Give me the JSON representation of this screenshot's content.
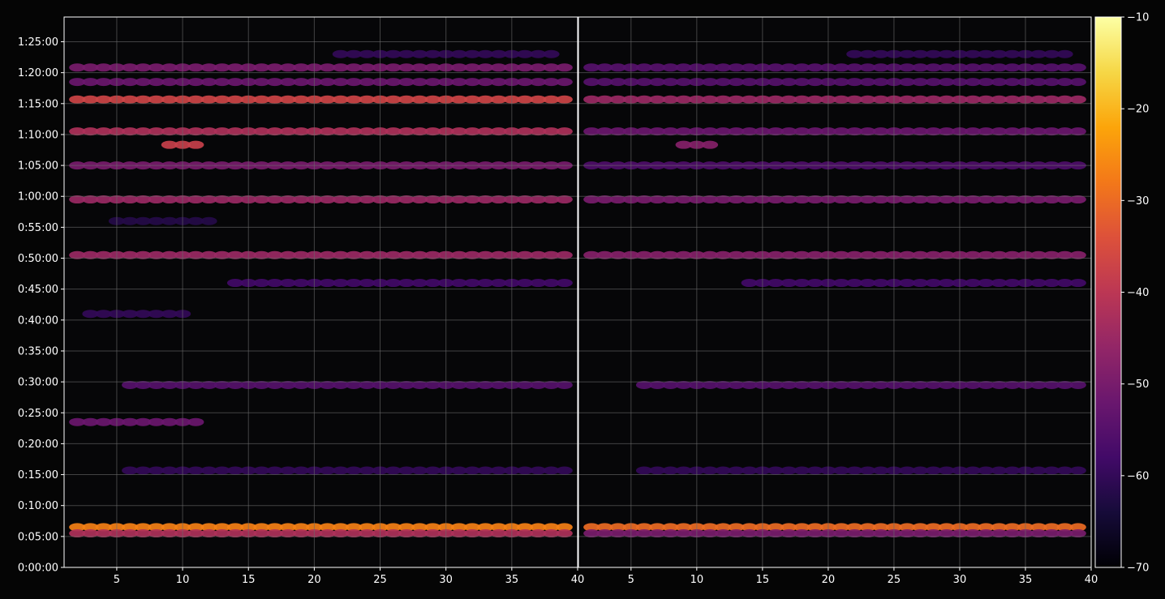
{
  "chart_data": {
    "type": "heatmap",
    "title": "",
    "xlabel": "",
    "ylabel": "",
    "panels": [
      {
        "name": "left",
        "xlim": [
          1,
          40
        ]
      },
      {
        "name": "right",
        "xlim": [
          40,
          40
        ]
      }
    ],
    "xlim": [
      1,
      40
    ],
    "x_ticks": [
      "5",
      "10",
      "15",
      "20",
      "25",
      "30",
      "35",
      "40"
    ],
    "x_ticks_right": [
      "5",
      "10",
      "15",
      "20",
      "25",
      "30",
      "35",
      "40"
    ],
    "ylim_seconds": [
      0,
      5340
    ],
    "y_ticks": [
      "0:00:00",
      "0:05:00",
      "0:10:00",
      "0:15:00",
      "0:20:00",
      "0:25:00",
      "0:30:00",
      "0:35:00",
      "0:40:00",
      "0:45:00",
      "0:50:00",
      "0:55:00",
      "1:00:00",
      "1:05:00",
      "1:10:00",
      "1:15:00",
      "1:20:00",
      "1:25:00"
    ],
    "grid": true,
    "colorbar": {
      "range": [
        -70,
        -10
      ],
      "ticks": [
        "−10",
        "−20",
        "−30",
        "−40",
        "−50",
        "−60",
        "−70"
      ],
      "colormap": "inferno"
    },
    "bands": [
      {
        "time": "0:06:30",
        "x_start": 2,
        "x_end": 39,
        "value_left": -27,
        "value_right": -30
      },
      {
        "time": "0:05:30",
        "x_start": 2,
        "x_end": 39,
        "value_left": -42,
        "value_right": -50
      },
      {
        "time": "0:15:40",
        "x_start": 6,
        "x_end": 39,
        "value_left": -60,
        "value_right": -60
      },
      {
        "time": "0:23:30",
        "x_start": 2,
        "x_end": 11,
        "value_left": -52,
        "value_right": -70
      },
      {
        "time": "0:29:30",
        "x_start": 6,
        "x_end": 39,
        "value_left": -55,
        "value_right": -55
      },
      {
        "time": "0:41:00",
        "x_start": 3,
        "x_end": 10,
        "value_left": -60,
        "value_right": -70
      },
      {
        "time": "0:46:00",
        "x_start": 14,
        "x_end": 39,
        "value_left": -58,
        "value_right": -58
      },
      {
        "time": "0:50:30",
        "x_start": 2,
        "x_end": 39,
        "value_left": -45,
        "value_right": -48
      },
      {
        "time": "0:56:00",
        "x_start": 5,
        "x_end": 12,
        "value_left": -62,
        "value_right": -70
      },
      {
        "time": "0:59:30",
        "x_start": 2,
        "x_end": 39,
        "value_left": -45,
        "value_right": -50
      },
      {
        "time": "1:05:00",
        "x_start": 2,
        "x_end": 39,
        "value_left": -50,
        "value_right": -56
      },
      {
        "time": "1:08:20",
        "x_start": 9,
        "x_end": 11,
        "value_left": -38,
        "value_right": -48
      },
      {
        "time": "1:10:30",
        "x_start": 2,
        "x_end": 39,
        "value_left": -42,
        "value_right": -52
      },
      {
        "time": "1:15:40",
        "x_start": 2,
        "x_end": 39,
        "value_left": -37,
        "value_right": -45
      },
      {
        "time": "1:18:30",
        "x_start": 2,
        "x_end": 39,
        "value_left": -52,
        "value_right": -55
      },
      {
        "time": "1:20:50",
        "x_start": 2,
        "x_end": 39,
        "value_left": -50,
        "value_right": -55
      },
      {
        "time": "1:23:00",
        "x_start": 22,
        "x_end": 38,
        "value_left": -60,
        "value_right": -60
      }
    ]
  },
  "theme": {
    "background": "#050505",
    "plot_background": "#060608",
    "grid_color": "#6b6b6b",
    "axis_color": "#ffffff"
  }
}
